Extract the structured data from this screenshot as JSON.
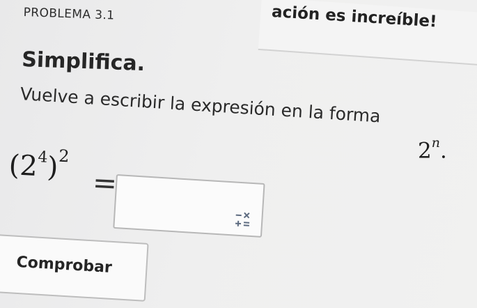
{
  "banner": {
    "text": "ación es increíble!"
  },
  "problem": {
    "label": "PROBLEMA 3.1",
    "heading": "Simplifica.",
    "instruction_prefix": "Vuelve a escribir la expresión en la forma",
    "target_base": "2",
    "target_exponent": "n",
    "target_suffix": "."
  },
  "expression": {
    "open_paren": "(",
    "base": "2",
    "inner_exponent": "4",
    "close_paren": ")",
    "outer_exponent": "2",
    "equals": "="
  },
  "answer": {
    "value": "",
    "math_icon": "math-keypad-icon"
  },
  "actions": {
    "check_label": "Comprobar"
  }
}
